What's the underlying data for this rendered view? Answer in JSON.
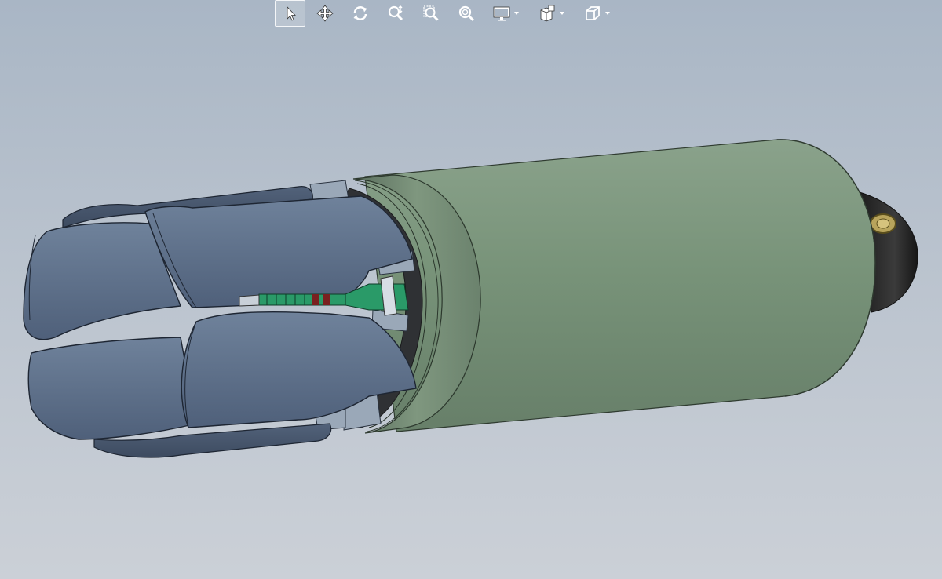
{
  "toolbar": {
    "items": [
      {
        "id": "select",
        "icon": "select-arrow-icon",
        "active": true
      },
      {
        "id": "pan",
        "icon": "pan-icon"
      },
      {
        "id": "rotate",
        "icon": "rotate-view-icon"
      },
      {
        "id": "zoom-in-out",
        "icon": "zoom-in-out-icon"
      },
      {
        "id": "zoom-to-area",
        "icon": "zoom-to-area-icon"
      },
      {
        "id": "zoom-to-fit",
        "icon": "zoom-to-fit-icon"
      },
      {
        "id": "display-style",
        "icon": "display-style-icon",
        "has_dropdown": true
      },
      {
        "id": "hide-show-items",
        "icon": "hide-show-items-icon",
        "has_dropdown": true
      },
      {
        "id": "view-orientation",
        "icon": "view-orientation-icon",
        "has_dropdown": true
      }
    ]
  },
  "colors": {
    "background_top": "#a9b6c5",
    "background_bottom": "#cbd0d7",
    "body_green": "#79947c",
    "petal_blue": "#5e7089",
    "spring_green": "#2a9a68",
    "spring_red": "#7a2020",
    "toolbar_icon": "#ffffff"
  }
}
